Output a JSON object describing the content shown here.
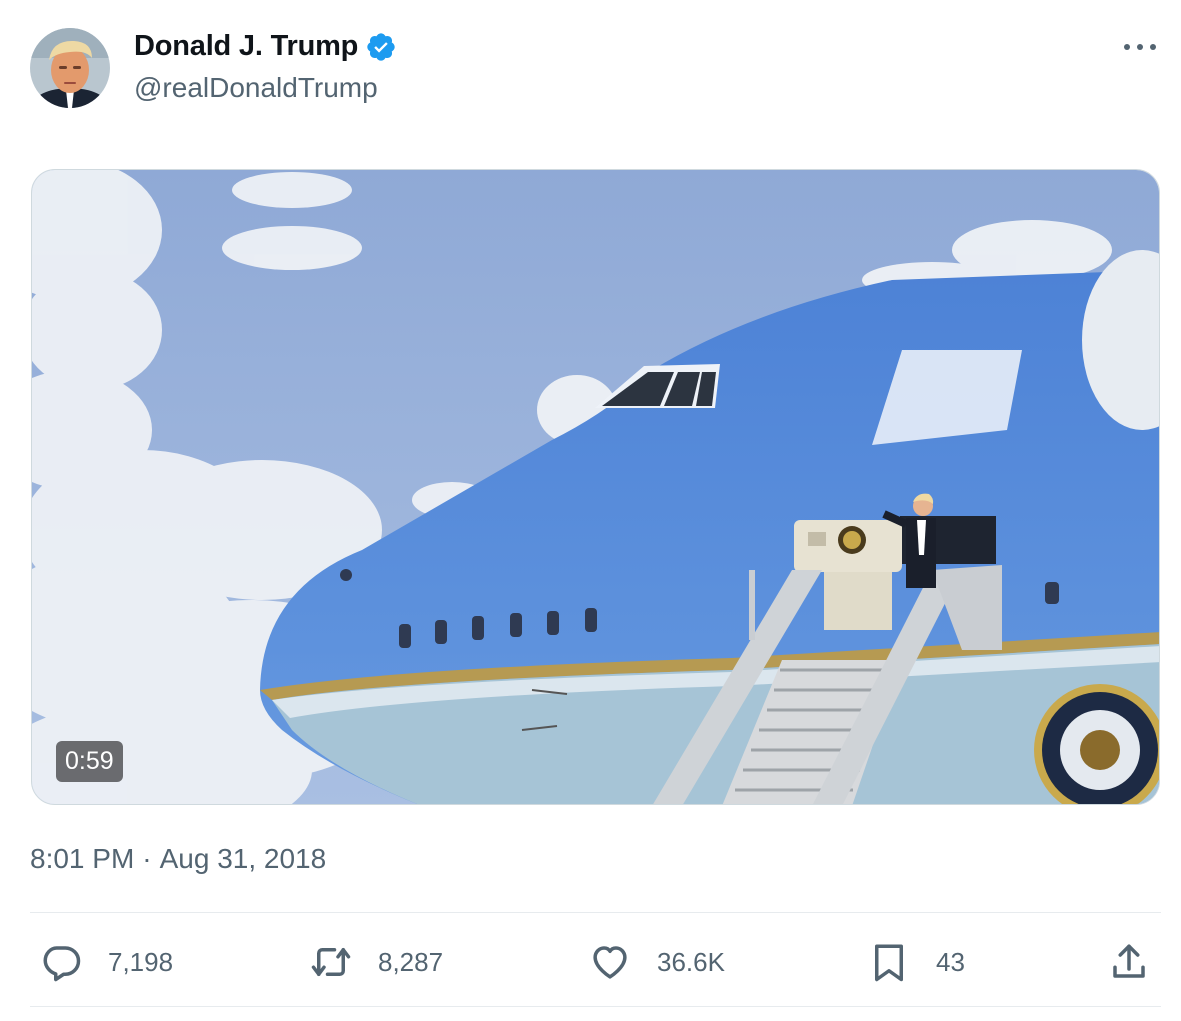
{
  "tweet": {
    "author": {
      "display_name": "Donald J. Trump",
      "handle": "@realDonaldTrump",
      "verified": true,
      "verified_color": "#1d9bf0"
    },
    "media": {
      "type": "video",
      "duration": "0:59"
    },
    "time": "8:01 PM",
    "separator": "·",
    "date": "Aug 31, 2018",
    "stats": {
      "replies": "7,198",
      "retweets": "8,287",
      "likes": "36.6K",
      "bookmarks": "43"
    }
  },
  "icons": {
    "more": "more-horizontal-icon",
    "reply": "reply-icon",
    "retweet": "retweet-icon",
    "like": "heart-icon",
    "bookmark": "bookmark-icon",
    "share": "share-icon"
  },
  "colors": {
    "text_primary": "#0f1419",
    "text_secondary": "#536471",
    "border": "#cfd9de"
  }
}
